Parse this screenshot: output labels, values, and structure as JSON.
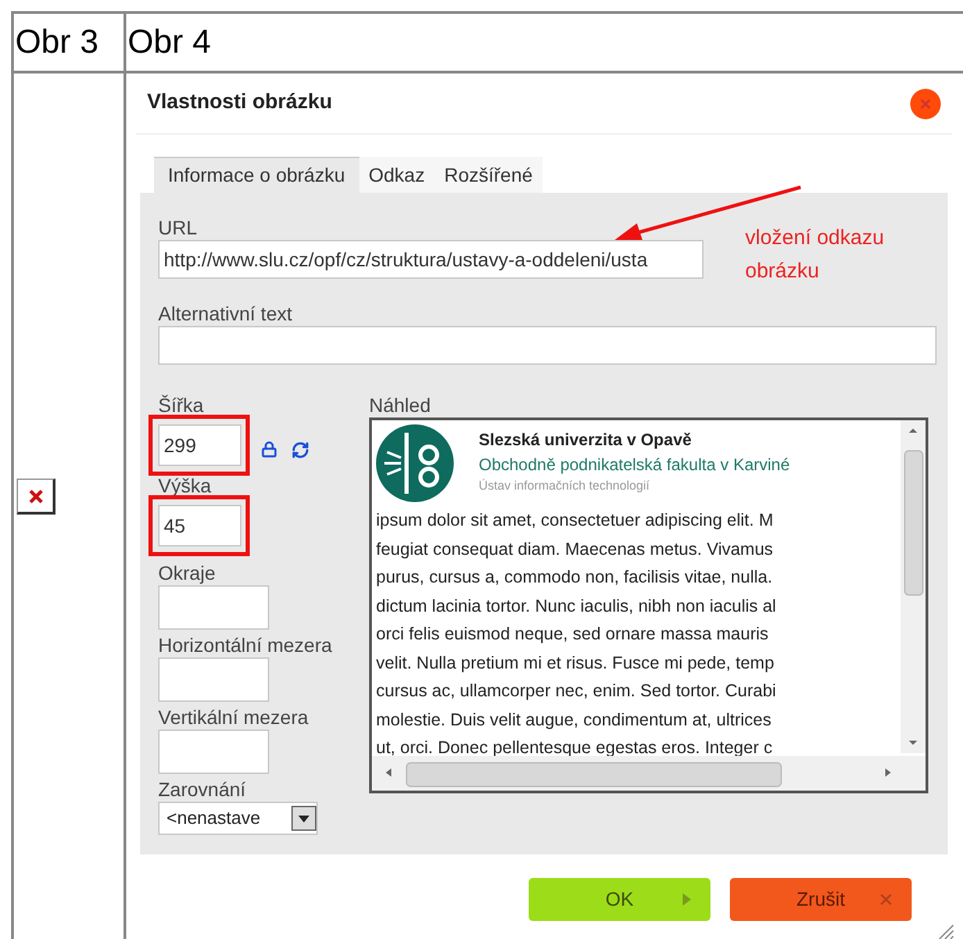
{
  "table": {
    "headers": [
      "Obr 3",
      "Obr 4"
    ]
  },
  "dialog": {
    "title": "Vlastnosti obrázku",
    "tabs": [
      {
        "label": "Informace o obrázku",
        "selected": true
      },
      {
        "label": "Odkaz",
        "selected": false
      },
      {
        "label": "Rozšířené",
        "selected": false
      }
    ],
    "url": {
      "label": "URL",
      "value": "http://www.slu.cz/opf/cz/struktura/ustavy-a-oddeleni/usta"
    },
    "annotation": "vložení odkazu obrázku",
    "alt_text": {
      "label": "Alternativní text"
    },
    "width": {
      "label": "Šířka",
      "value": "299",
      "highlighted": true
    },
    "height": {
      "label": "Výška",
      "value": "45",
      "highlighted": true
    },
    "spacing_fields": [
      {
        "label": "Okraje"
      },
      {
        "label": "Horizontální mezera"
      },
      {
        "label": "Vertikální mezera"
      }
    ],
    "alignment": {
      "label": "Zarovnání",
      "value": "<nenastave"
    },
    "preview": {
      "label": "Náhled",
      "header": [
        "Slezská univerzita v Opavě",
        "Obchodně podnikatelská fakulta v Karviné",
        "Ústav informačních technologií"
      ],
      "lines": [
        "ipsum dolor sit amet, consectetuer adipiscing elit. M",
        "feugiat consequat diam. Maecenas metus. Vivamus",
        "purus, cursus a, commodo non, facilisis vitae, nulla.",
        "dictum lacinia tortor. Nunc iaculis, nibh non iaculis al",
        "orci felis euismod neque, sed ornare massa mauris",
        "velit. Nulla pretium mi et risus. Fusce mi pede, temp",
        "cursus ac, ullamcorper nec, enim. Sed tortor. Curabi",
        "molestie. Duis velit augue, condimentum at, ultrices",
        "ut, orci. Donec pellentesque egestas eros. Integer c"
      ]
    },
    "buttons": [
      {
        "label": "OK",
        "kind": "ok"
      },
      {
        "label": "Zrušit",
        "kind": "cancel"
      }
    ]
  }
}
